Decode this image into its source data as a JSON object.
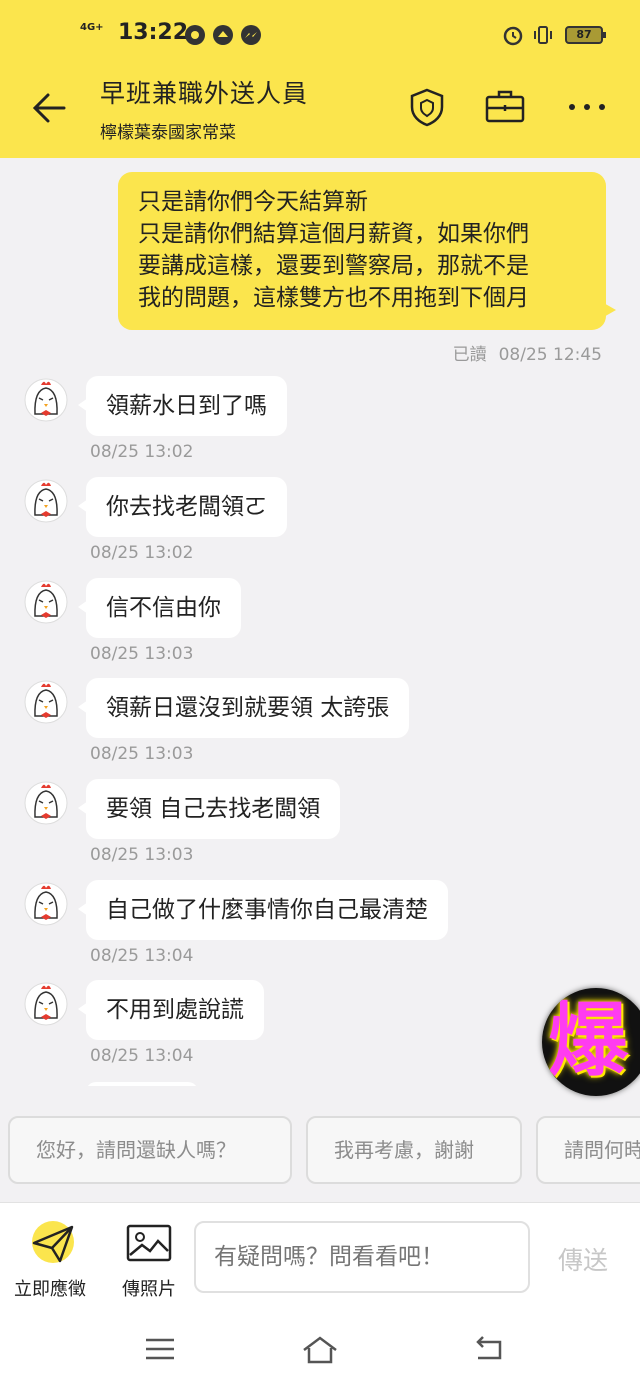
{
  "status_bar": {
    "network": "4G+",
    "time": "13:22",
    "battery": "87",
    "icons": [
      "chrome-icon",
      "whatsapp-like-icon",
      "messenger-icon",
      "alarm-icon",
      "vibrate-icon"
    ]
  },
  "header": {
    "title": "早班兼職外送人員",
    "subtitle": "檸檬葉泰國家常菜",
    "icons": [
      "back-arrow-icon",
      "shield-icon",
      "briefcase-icon",
      "more-icon"
    ]
  },
  "outgoing": {
    "lines": [
      "只是請你們今天結算新",
      "只是請你們結算這個月薪資，如果你們",
      "要講成這樣，還要到警察局，那就不是",
      "我的問題，這樣雙方也不用拖到下個月"
    ],
    "read_label": "已讀",
    "time": "08/25 12:45"
  },
  "messages": [
    {
      "text": "領薪水日到了嗎",
      "time": "08/25 13:02"
    },
    {
      "text": "你去找老闆領ㄛ",
      "time": "08/25 13:02"
    },
    {
      "text": "信不信由你",
      "time": "08/25 13:03"
    },
    {
      "text": "領薪日還沒到就要領 太誇張",
      "time": "08/25 13:03"
    },
    {
      "text": "要領 自己去找老闆領",
      "time": "08/25 13:03"
    },
    {
      "text": "自己做了什麼事情你自己最清楚",
      "time": "08/25 13:04"
    },
    {
      "text": "不用到處說謊",
      "time": "08/25 13:04"
    }
  ],
  "sticker": {
    "text": "爆"
  },
  "quick_replies": [
    "您好，請問還缺人嗎？",
    "我再考慮，謝謝",
    "請問何時"
  ],
  "bottom_bar": {
    "apply_label": "立即應徵",
    "photo_label": "傳照片",
    "input_placeholder": "有疑問嗎？問看看吧！",
    "send_label": "傳送"
  },
  "colors": {
    "accent": "#fbe54d",
    "background": "#f2f1f3"
  }
}
